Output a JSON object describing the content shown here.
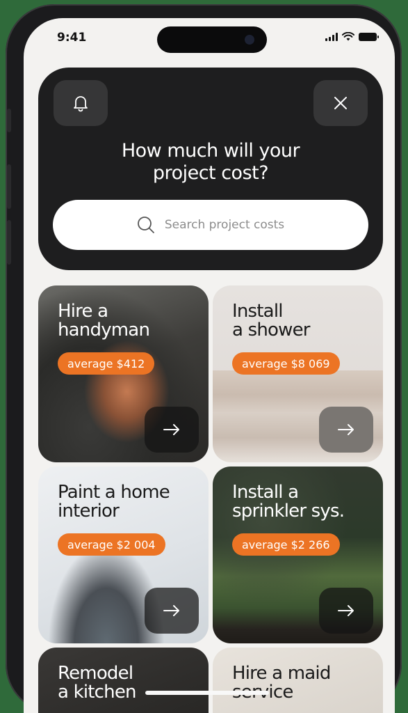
{
  "status_bar": {
    "time": "9:41"
  },
  "hero": {
    "title": "How much will your\nproject cost?",
    "search_placeholder": "Search project costs",
    "bell_icon": "bell-icon",
    "close_icon": "close-icon"
  },
  "cards": [
    {
      "title": "Hire a\nhandyman",
      "badge": "average $412"
    },
    {
      "title": "Install\na shower",
      "badge": "average $8 069"
    },
    {
      "title": "Paint a home\ninterior",
      "badge": "average $2 004"
    },
    {
      "title": "Install a\nsprinkler sys.",
      "badge": "average $2 266"
    },
    {
      "title": "Remodel\na kitchen"
    },
    {
      "title": "Hire a maid\nservice"
    }
  ],
  "colors": {
    "accent": "#ec7424",
    "hero_bg": "#1e1e1f",
    "screen_bg": "#f3f2f0"
  }
}
